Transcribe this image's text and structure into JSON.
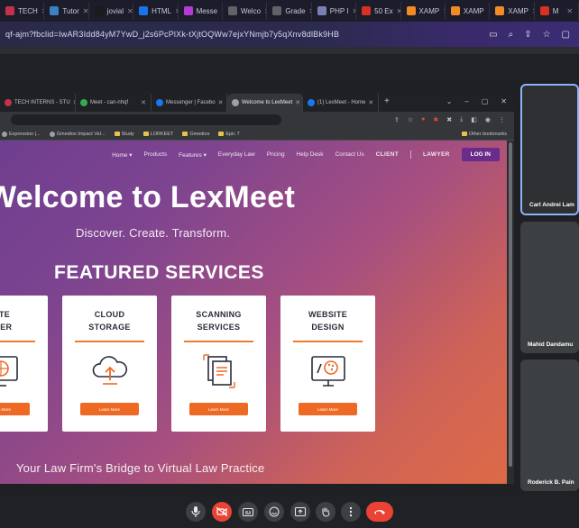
{
  "outer_tabs": [
    {
      "label": "TECH",
      "color": "#c4314b"
    },
    {
      "label": "Tutor",
      "color": "#3b82c4"
    },
    {
      "label": "jovial",
      "color": "#1b1b1b"
    },
    {
      "label": "HTML",
      "color": "#1a73e8"
    },
    {
      "label": "Messe",
      "color": "#b23bd6"
    },
    {
      "label": "Welco",
      "color": "#5f6368"
    },
    {
      "label": "Grade",
      "color": "#5f6368"
    },
    {
      "label": "PHP I",
      "color": "#7b7fb5"
    },
    {
      "label": "50 Ex",
      "color": "#d93025"
    },
    {
      "label": "XAMP",
      "color": "#f28b25"
    },
    {
      "label": "XAMP",
      "color": "#f28b25"
    },
    {
      "label": "XAMP",
      "color": "#f28b25"
    },
    {
      "label": "M",
      "color": "#d93025"
    }
  ],
  "outer_url": "qf-ajm?fbclid=IwAR3Idd84yM7YwD_j2s6PcPlXk-tXjtOQWw7ejxYNmjb7y5qXnv8dlBk9HB",
  "inner_tabs": [
    {
      "label": "TECH INTERNS - STU",
      "color": "#c4314b",
      "active": false
    },
    {
      "label": "Meet - can-nhqf",
      "color": "#34a853",
      "active": false
    },
    {
      "label": "Messenger | Facebo",
      "color": "#1877f2",
      "active": false
    },
    {
      "label": "Welcome to LexMeet",
      "color": "#9aa0a6",
      "active": true
    },
    {
      "label": "(1) LexMeet - Home",
      "color": "#1877f2",
      "active": false
    }
  ],
  "bookmarks": [
    {
      "label": "Expression |...",
      "folder": false
    },
    {
      "label": "Gmedios Impact Vel...",
      "folder": false
    },
    {
      "label": "Study",
      "folder": true
    },
    {
      "label": "LORKEET",
      "folder": true
    },
    {
      "label": "Gmedios",
      "folder": true
    },
    {
      "label": "Epic 7",
      "folder": true
    }
  ],
  "other_bookmarks": "Other bookmarks",
  "nav": {
    "home": "Home",
    "products": "Products",
    "features": "Features",
    "everyday_law": "Everyday Law",
    "pricing": "Pricing",
    "help_desk": "Help Desk",
    "contact": "Contact Us",
    "client": "CLIENT",
    "lawyer": "LAWYER",
    "login": "LOG IN"
  },
  "hero": {
    "title": "Welcome to LexMeet",
    "subtitle": "Discover. Create. Transform.",
    "featured": "FEATURED SERVICES",
    "tagline": "Your Law Firm's Bridge to Virtual Law Practice"
  },
  "services": [
    {
      "title": "SITE\nLDER",
      "icon": "website-builder-icon",
      "button": "Learn More"
    },
    {
      "title": "CLOUD\nSTORAGE",
      "icon": "cloud-storage-icon",
      "button": "Learn More"
    },
    {
      "title": "SCANNING\nSERVICES",
      "icon": "scanning-icon",
      "button": "Learn More"
    },
    {
      "title": "WEBSITE\nDESIGN",
      "icon": "website-design-icon",
      "button": "Learn More"
    }
  ],
  "participants": [
    {
      "name": "Carl Andrei Lam"
    },
    {
      "name": "Mahid Dandamu"
    },
    {
      "name": "Roderick B. Pain"
    }
  ],
  "colors": {
    "accent_orange": "#ee6a24",
    "login_purple": "#6a2c8a",
    "end_call_red": "#ea4335"
  }
}
